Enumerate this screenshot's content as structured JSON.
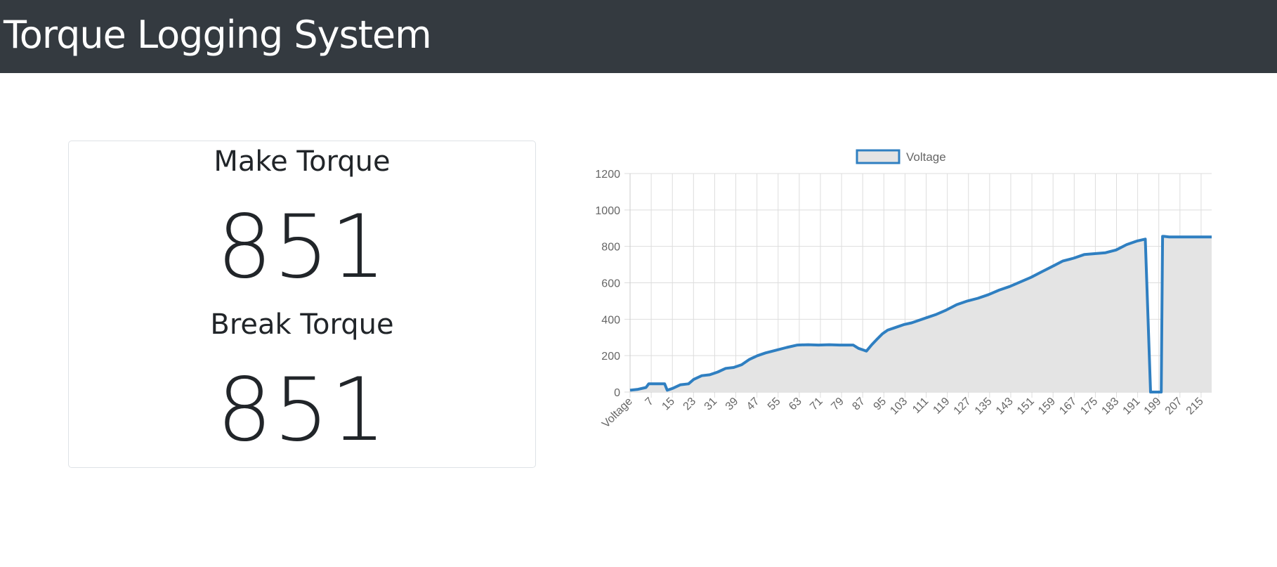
{
  "header": {
    "title": "Torque Logging System"
  },
  "make": {
    "label": "Make Torque",
    "value": "851"
  },
  "break": {
    "label": "Break Torque",
    "value": "851"
  },
  "colors": {
    "navbar": "#343a40",
    "line": "#2f7fc1",
    "fill": "#e4e4e4",
    "grid": "#dddddd"
  },
  "chart_data": {
    "type": "area",
    "legend": [
      "Voltage"
    ],
    "legend_position": "top",
    "grid": true,
    "ylim": [
      0,
      1200
    ],
    "yticks": [
      0,
      200,
      400,
      600,
      800,
      1000,
      1200
    ],
    "xticks": [
      "Voltage",
      "7",
      "15",
      "23",
      "31",
      "39",
      "47",
      "55",
      "63",
      "71",
      "79",
      "87",
      "95",
      "103",
      "111",
      "119",
      "127",
      "135",
      "143",
      "151",
      "159",
      "167",
      "175",
      "183",
      "191",
      "199",
      "207",
      "215"
    ],
    "x_range": [
      0,
      219
    ],
    "series": [
      {
        "name": "Voltage",
        "x": [
          0,
          3,
          6,
          7,
          10,
          13,
          14,
          16,
          19,
          22,
          24,
          27,
          30,
          33,
          36,
          39,
          42,
          45,
          48,
          51,
          55,
          59,
          63,
          67,
          71,
          75,
          79,
          84,
          86,
          88,
          89,
          91,
          93,
          95,
          97,
          99,
          101,
          103,
          106,
          109,
          112,
          115,
          119,
          123,
          127,
          131,
          135,
          139,
          143,
          147,
          151,
          155,
          159,
          163,
          167,
          171,
          175,
          179,
          183,
          187,
          191,
          194,
          196,
          197,
          198,
          199,
          200,
          200.5,
          201,
          203,
          210,
          219
        ],
        "y": [
          10,
          15,
          25,
          45,
          45,
          45,
          10,
          20,
          40,
          45,
          70,
          90,
          95,
          110,
          130,
          135,
          150,
          180,
          200,
          215,
          230,
          245,
          258,
          260,
          258,
          260,
          258,
          258,
          240,
          230,
          225,
          260,
          290,
          320,
          340,
          350,
          360,
          370,
          380,
          395,
          410,
          425,
          450,
          480,
          500,
          515,
          535,
          560,
          580,
          605,
          630,
          660,
          690,
          720,
          735,
          755,
          760,
          765,
          780,
          810,
          830,
          840,
          0,
          0,
          0,
          0,
          0,
          855,
          855,
          852,
          852,
          852
        ]
      }
    ]
  }
}
